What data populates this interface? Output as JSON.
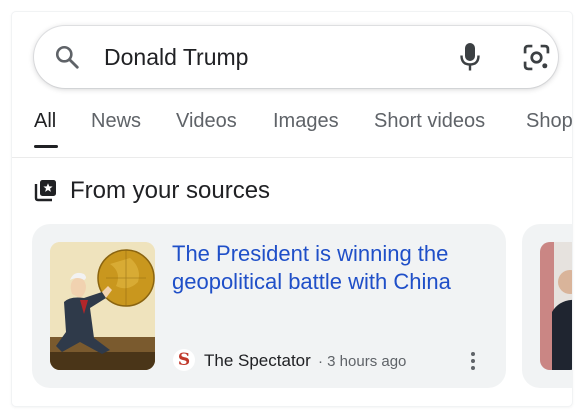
{
  "search": {
    "query": "Donald Trump"
  },
  "tabs": [
    {
      "label": "All",
      "active": true
    },
    {
      "label": "News",
      "active": false
    },
    {
      "label": "Videos",
      "active": false
    },
    {
      "label": "Images",
      "active": false
    },
    {
      "label": "Short videos",
      "active": false
    },
    {
      "label": "Shop",
      "active": false
    }
  ],
  "section": {
    "title": "From your sources",
    "icon": "news-sources-icon"
  },
  "cards": [
    {
      "headline": "The President is winning the geopolitical battle with China",
      "source_logo": "S",
      "source": "The Spectator",
      "time": "· 3 hours ago"
    }
  ],
  "colors": {
    "headline_link": "#1f4fc8",
    "card_background": "#f1f3f4",
    "text_primary": "#202124",
    "text_secondary": "#5f6368",
    "source_logo": "#c0392b"
  }
}
